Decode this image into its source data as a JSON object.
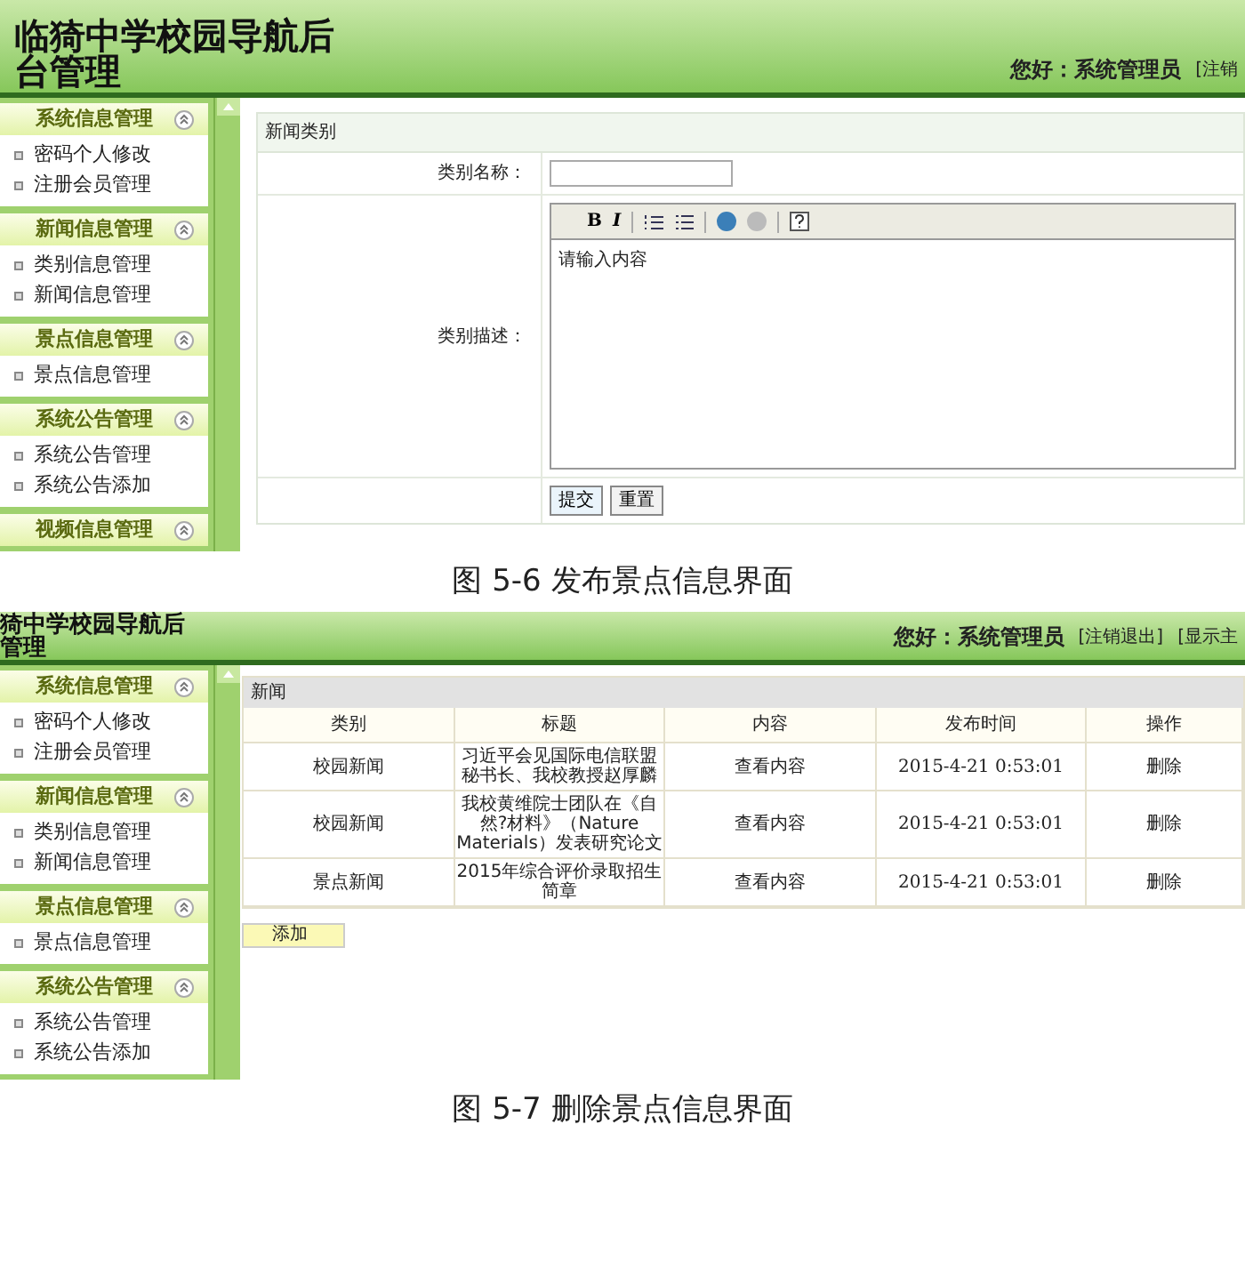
{
  "figures": [
    {
      "kind": "form",
      "header": {
        "title_lines": [
          "临猗中学校园导航后",
          "台管理"
        ],
        "greeting": "您好：系统管理员",
        "links": [
          "[注销"
        ]
      },
      "sidebar": {
        "groups": [
          {
            "title": "系统信息管理",
            "items": [
              "密码个人修改",
              "注册会员管理"
            ]
          },
          {
            "title": "新闻信息管理",
            "items": [
              "类别信息管理",
              "新闻信息管理"
            ]
          },
          {
            "title": "景点信息管理",
            "items": [
              "景点信息管理"
            ]
          },
          {
            "title": "系统公告管理",
            "items": [
              "系统公告管理",
              "系统公告添加"
            ]
          },
          {
            "title": "视频信息管理"
          }
        ]
      },
      "form": {
        "section_title": "新闻类别",
        "fields": [
          {
            "kind": "input",
            "label": "类别名称："
          },
          {
            "kind": "editor",
            "label": "类别描述：",
            "toolbar": [
              "B",
              "I"
            ],
            "content": "请输入内容"
          }
        ],
        "buttons": [
          "提交",
          "重置"
        ]
      },
      "caption": "图 5-6 发布景点信息界面"
    },
    {
      "kind": "table",
      "header": {
        "title_lines": [
          "猗中学校园导航后",
          "管理"
        ],
        "greeting": "您好：系统管理员",
        "links": [
          "[注销退出]",
          "[显示主"
        ]
      },
      "sidebar": {
        "groups": [
          {
            "title": "系统信息管理",
            "items": [
              "密码个人修改",
              "注册会员管理"
            ]
          },
          {
            "title": "新闻信息管理",
            "items": [
              "类别信息管理",
              "新闻信息管理"
            ]
          },
          {
            "title": "景点信息管理",
            "items": [
              "景点信息管理"
            ]
          },
          {
            "title": "系统公告管理",
            "items": [
              "系统公告管理",
              "系统公告添加"
            ]
          }
        ]
      },
      "table": {
        "section_title": "新闻",
        "columns": [
          "类别",
          "标题",
          "内容",
          "发布时间",
          "操作"
        ],
        "rows": [
          [
            "校园新闻",
            "习近平会见国际电信联盟秘书长、我校教授赵厚麟",
            "查看内容",
            "2015-4-21 0:53:01",
            "删除"
          ],
          [
            "校园新闻",
            "我校黄维院士团队在《自然?材料》（Nature Materials）发表研究论文",
            "查看内容",
            "2015-4-21 0:53:01",
            "删除"
          ],
          [
            "景点新闻",
            "2015年综合评价录取招生简章",
            "查看内容",
            "2015-4-21 0:53:01",
            "删除"
          ]
        ],
        "add_button": "添加"
      },
      "caption": "图 5-7 删除景点信息界面"
    }
  ]
}
